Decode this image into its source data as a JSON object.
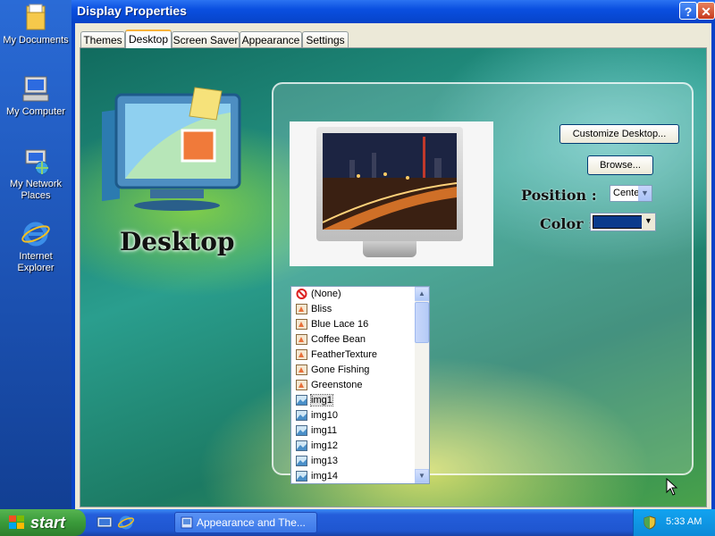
{
  "desktop_icons": [
    {
      "label": "My Documents",
      "icon": "folder-icon"
    },
    {
      "label": "My Computer",
      "icon": "computer-icon"
    },
    {
      "label": "My Network Places",
      "icon": "network-icon"
    },
    {
      "label": "Internet Explorer",
      "icon": "ie-icon"
    }
  ],
  "window": {
    "title": "Display Properties",
    "help_label": "?",
    "close_label": "✕"
  },
  "tabs": [
    {
      "label": "Themes",
      "active": false
    },
    {
      "label": "Desktop",
      "active": true
    },
    {
      "label": "Screen Saver",
      "active": false
    },
    {
      "label": "Appearance",
      "active": false
    },
    {
      "label": "Settings",
      "active": false
    }
  ],
  "desktop_tab": {
    "hero_label": "Desktop",
    "customize_button": "Customize Desktop...",
    "browse_button": "Browse...",
    "position_label": "Position :",
    "position_value": "Center",
    "color_label": "Color :",
    "color_value": "#0a3a8c",
    "backgrounds": [
      {
        "label": "(None)",
        "icon": "none-icon"
      },
      {
        "label": "Bliss",
        "icon": "image-icon"
      },
      {
        "label": "Blue Lace 16",
        "icon": "image-icon"
      },
      {
        "label": "Coffee Bean",
        "icon": "image-icon"
      },
      {
        "label": "FeatherTexture",
        "icon": "image-icon"
      },
      {
        "label": "Gone Fishing",
        "icon": "image-icon"
      },
      {
        "label": "Greenstone",
        "icon": "image-icon"
      },
      {
        "label": "img1",
        "icon": "picture-icon",
        "selected": true
      },
      {
        "label": "img10",
        "icon": "picture-icon"
      },
      {
        "label": "img11",
        "icon": "picture-icon"
      },
      {
        "label": "img12",
        "icon": "picture-icon"
      },
      {
        "label": "img13",
        "icon": "picture-icon"
      },
      {
        "label": "img14",
        "icon": "picture-icon"
      }
    ]
  },
  "taskbar": {
    "start_label": "start",
    "task_button": "Appearance and The...",
    "clock": "5:33 AM"
  }
}
